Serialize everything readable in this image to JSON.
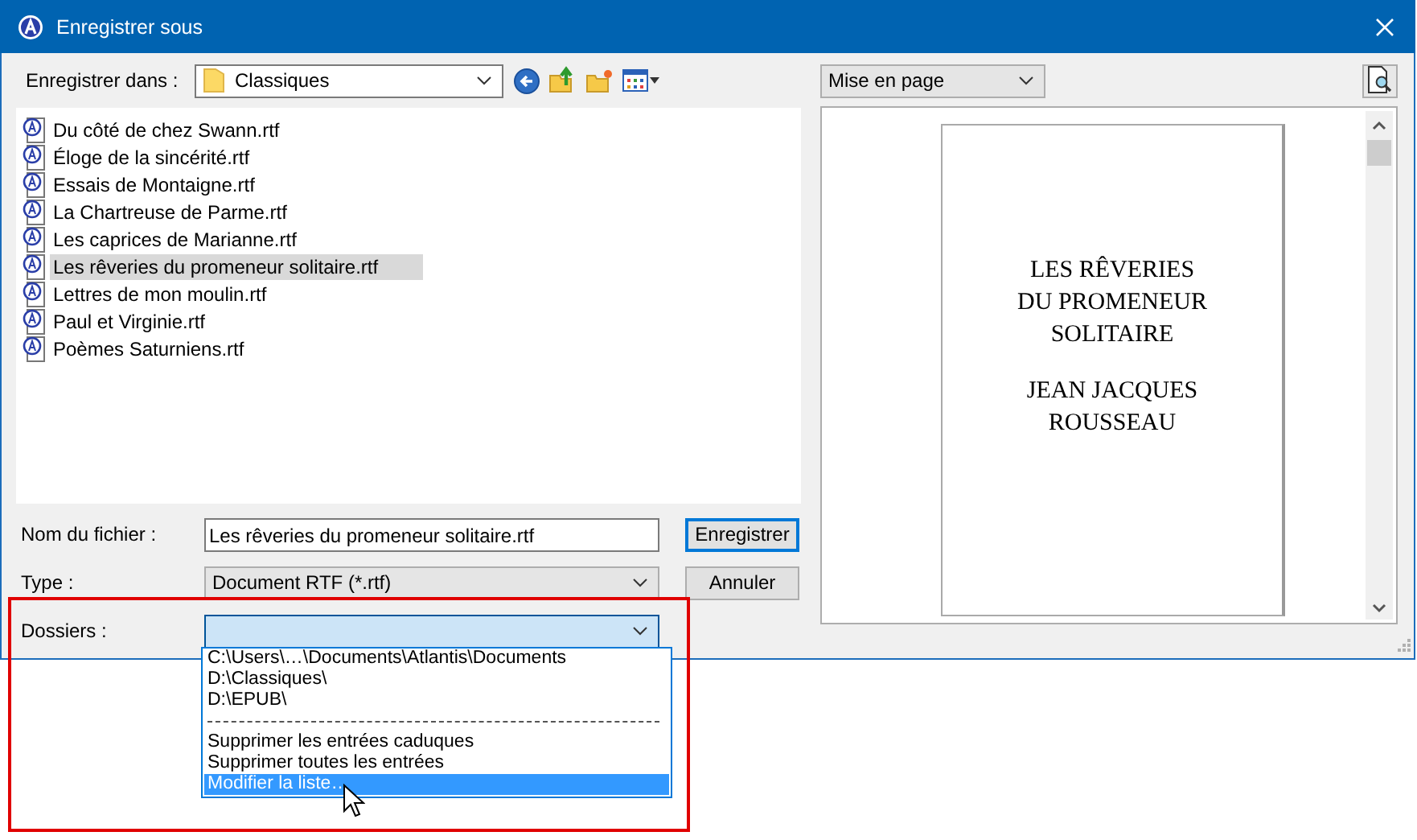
{
  "window": {
    "title": "Enregistrer sous"
  },
  "location": {
    "label": "Enregistrer dans :",
    "value": "Classiques"
  },
  "files": [
    {
      "name": "Du côté de chez Swann.rtf",
      "selected": false
    },
    {
      "name": "Éloge de la sincérité.rtf",
      "selected": false
    },
    {
      "name": "Essais de Montaigne.rtf",
      "selected": false
    },
    {
      "name": "La Chartreuse de Parme.rtf",
      "selected": false
    },
    {
      "name": "Les caprices de Marianne.rtf",
      "selected": false
    },
    {
      "name": "Les rêveries du promeneur solitaire.rtf",
      "selected": true
    },
    {
      "name": "Lettres de mon moulin.rtf",
      "selected": false
    },
    {
      "name": "Paul et Virginie.rtf",
      "selected": false
    },
    {
      "name": "Poèmes Saturniens.rtf",
      "selected": false
    }
  ],
  "filename": {
    "label": "Nom du fichier :",
    "value": "Les rêveries du promeneur solitaire.rtf"
  },
  "type": {
    "label": "Type :",
    "value": "Document RTF (*.rtf)"
  },
  "folders": {
    "label": "Dossiers :",
    "options": [
      {
        "kind": "item",
        "text": "C:\\Users\\…\\Documents\\Atlantis\\Documents",
        "selected": false
      },
      {
        "kind": "item",
        "text": "D:\\Classiques\\",
        "selected": false
      },
      {
        "kind": "item",
        "text": "D:\\EPUB\\",
        "selected": false
      },
      {
        "kind": "separator"
      },
      {
        "kind": "item",
        "text": "Supprimer les entrées caduques",
        "selected": false
      },
      {
        "kind": "item",
        "text": "Supprimer toutes les entrées",
        "selected": false
      },
      {
        "kind": "item",
        "text": "Modifier la liste…",
        "selected": true
      }
    ]
  },
  "buttons": {
    "save": "Enregistrer",
    "cancel": "Annuler"
  },
  "preview": {
    "mode": "Mise en page",
    "title_lines": [
      "LES RÊVERIES",
      "DU PROMENEUR",
      "SOLITAIRE"
    ],
    "author_lines": [
      "JEAN JACQUES",
      "ROUSSEAU"
    ]
  }
}
